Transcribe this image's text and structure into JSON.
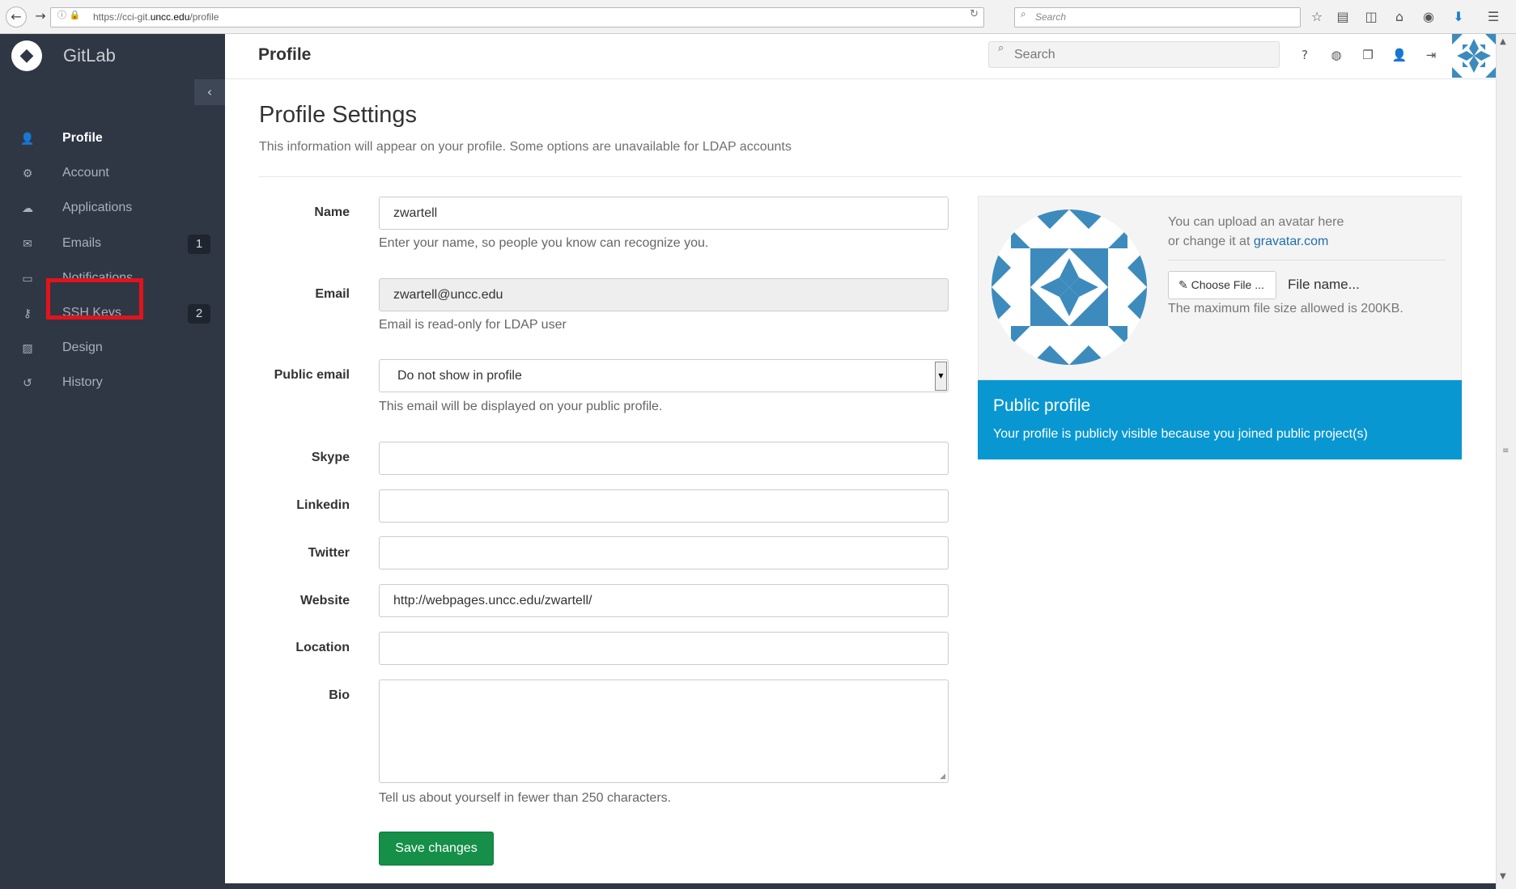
{
  "browser": {
    "url_prefix": "https://cci-git.",
    "url_host": "uncc.edu",
    "url_path": "/profile",
    "search_placeholder": "Search"
  },
  "sidebar": {
    "brand": "GitLab",
    "collapse_icon": "chevron-left-icon",
    "items": [
      {
        "label": "Profile",
        "icon": "user-icon",
        "badge": "",
        "active": true
      },
      {
        "label": "Account",
        "icon": "gear-icon",
        "badge": ""
      },
      {
        "label": "Applications",
        "icon": "cloud-icon",
        "badge": ""
      },
      {
        "label": "Emails",
        "icon": "envelope-icon",
        "badge": "1"
      },
      {
        "label": "Notifications",
        "icon": "inbox-icon",
        "badge": ""
      },
      {
        "label": "SSH Keys",
        "icon": "key-icon",
        "badge": "2"
      },
      {
        "label": "Design",
        "icon": "image-icon",
        "badge": ""
      },
      {
        "label": "History",
        "icon": "history-icon",
        "badge": ""
      }
    ],
    "highlight_color": "#e3131b"
  },
  "topbar": {
    "title": "Profile",
    "search_placeholder": "Search",
    "icons": [
      "question-icon",
      "globe-icon",
      "copy-icon",
      "user-icon",
      "sign-out-icon"
    ]
  },
  "main": {
    "title": "Profile Settings",
    "subtitle": "This information will appear on your profile. Some options are unavailable for LDAP accounts",
    "fields": {
      "name": {
        "label": "Name",
        "value": "zwartell",
        "help": "Enter your name, so people you know can recognize you."
      },
      "email": {
        "label": "Email",
        "value": "zwartell@uncc.edu",
        "help": "Email is read-only for LDAP user"
      },
      "public_email": {
        "label": "Public email",
        "value": "Do not show in profile",
        "help": "This email will be displayed on your public profile."
      },
      "skype": {
        "label": "Skype",
        "value": ""
      },
      "linkedin": {
        "label": "Linkedin",
        "value": ""
      },
      "twitter": {
        "label": "Twitter",
        "value": ""
      },
      "website": {
        "label": "Website",
        "value": "http://webpages.uncc.edu/zwartell/"
      },
      "location": {
        "label": "Location",
        "value": ""
      },
      "bio": {
        "label": "Bio",
        "value": "",
        "help": "Tell us about yourself in fewer than 250 characters."
      }
    },
    "save_label": "Save changes"
  },
  "avatar_panel": {
    "line1": "You can upload an avatar here",
    "line2_prefix": "or change it at ",
    "gravatar_link": "gravatar.com",
    "choose_file_label": "✎ Choose File ...",
    "file_name": "File name...",
    "max_size": "The maximum file size allowed is 200KB."
  },
  "public_panel": {
    "title": "Public profile",
    "description": "Your profile is publicly visible because you joined public project(s)"
  },
  "colors": {
    "sidebar_bg": "#2f3744",
    "save_green": "#168f48",
    "public_blue": "#0897d1",
    "identicon_blue": "#3d8bbd"
  }
}
